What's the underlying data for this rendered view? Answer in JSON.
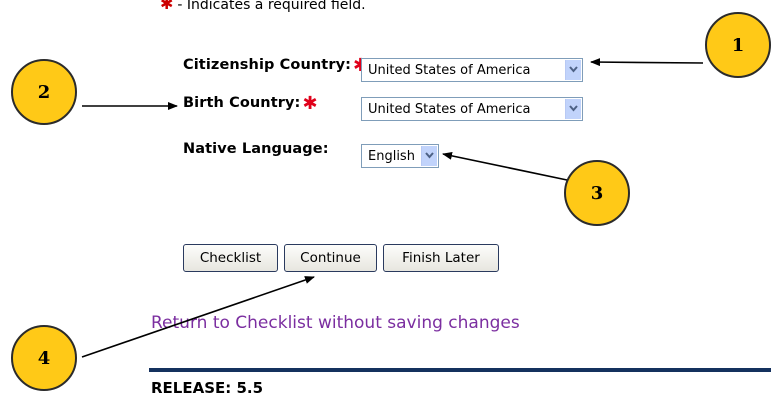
{
  "required_note": "- Indicates a required field.",
  "form": {
    "citizenship": {
      "label": "Citizenship Country:",
      "value": "United States of America"
    },
    "birth": {
      "label": "Birth Country:",
      "value": "United States of America"
    },
    "language": {
      "label": "Native Language:",
      "value": "English"
    }
  },
  "buttons": {
    "checklist": "Checklist",
    "continue": "Continue",
    "finish_later": "Finish Later"
  },
  "return_link": "Return to Checklist without saving changes",
  "release": "RELEASE: 5.5",
  "callouts": [
    "1",
    "2",
    "3",
    "4"
  ],
  "colors": {
    "callout_fill": "#ffc917",
    "required_star": "#e0001a",
    "link": "#7b2ea0",
    "rule": "#14315e"
  }
}
